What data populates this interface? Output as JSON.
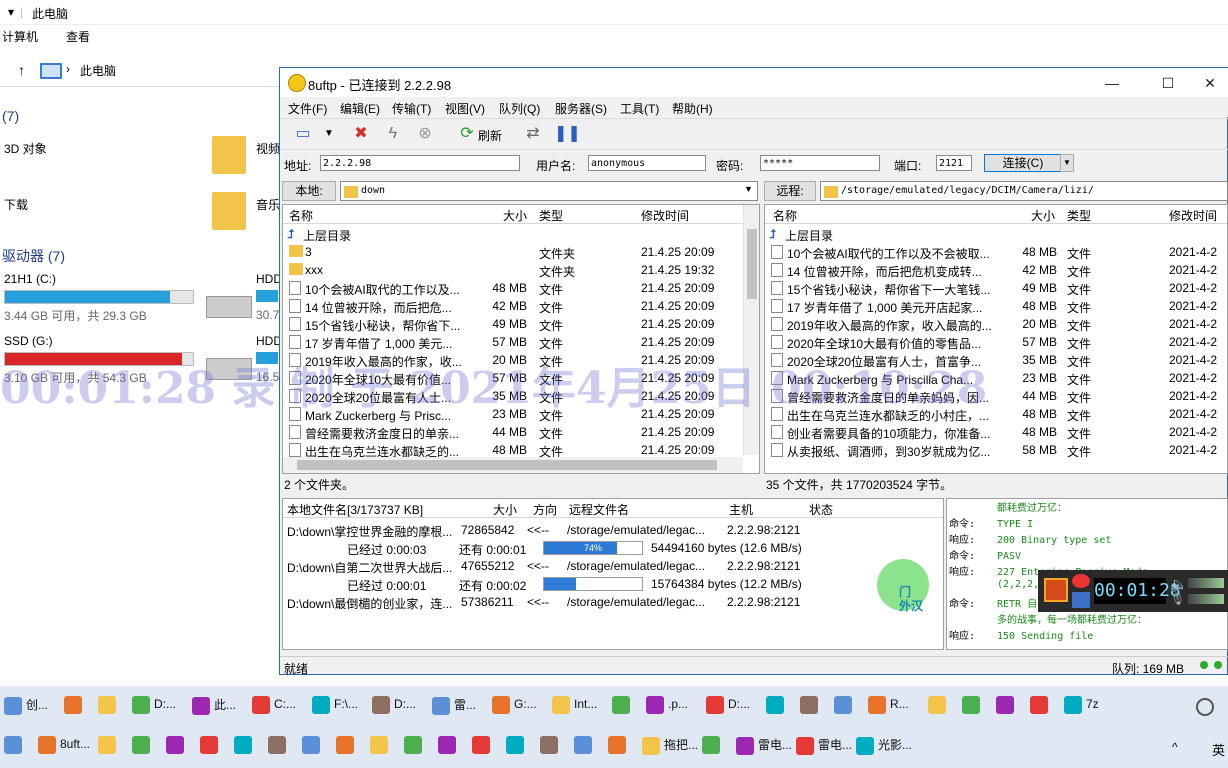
{
  "explorer": {
    "title": "此电脑",
    "menu": [
      "计算机",
      "查看"
    ],
    "address": "此电脑",
    "folders_header": "(7)",
    "folders": [
      {
        "label": "3D 对象"
      },
      {
        "label": "视频"
      },
      {
        "label": "下载"
      },
      {
        "label": "音乐"
      }
    ],
    "drives_header": "驱动器 (7)",
    "drives": [
      {
        "name": "21H1 (C:)",
        "info": "3.44 GB 可用，共 29.3 GB",
        "used": 0.88,
        "color": "#26a0da"
      },
      {
        "name": "SSD (G:)",
        "info": "3.10 GB 可用，共 54.3 GB",
        "used": 0.94,
        "color": "#da2626"
      },
      {
        "name": "HDD",
        "info": "30.7",
        "used": 0.5,
        "color": "#26a0da"
      },
      {
        "name": "HDD",
        "info": "16.5",
        "used": 0.5,
        "color": "#26a0da"
      }
    ]
  },
  "window": {
    "title": "8uftp - 已连接到 2.2.2.98",
    "controls": [
      "—",
      "☐",
      "✕"
    ],
    "menu": [
      "文件(F)",
      "编辑(E)",
      "传输(T)",
      "视图(V)",
      "队列(Q)",
      "服务器(S)",
      "工具(T)",
      "帮助(H)"
    ],
    "toolbar": {
      "refresh": "刷新"
    },
    "connection": {
      "addr_label": "地址:",
      "addr": "2.2.2.98",
      "user_label": "用户名:",
      "user": "anonymous",
      "pwd_label": "密码:",
      "pwd": "*****",
      "port_label": "端口:",
      "port": "2121",
      "connect": "连接(C)"
    },
    "local": {
      "label": "本地:",
      "path": "down",
      "headers": {
        "name": "名称",
        "size": "大小",
        "type": "类型",
        "mtime": "修改时间"
      },
      "parent": "上层目录",
      "rows": [
        {
          "name": "3",
          "size": "",
          "type": "文件夹",
          "mtime": "21.4.25 20:09",
          "dir": true
        },
        {
          "name": "xxx",
          "size": "",
          "type": "文件夹",
          "mtime": "21.4.25 19:32",
          "dir": true
        },
        {
          "name": "10个会被AI取代的工作以及...",
          "size": "48 MB",
          "type": "文件",
          "mtime": "21.4.25 20:09"
        },
        {
          "name": "14 位曾被开除，而后把危...",
          "size": "42 MB",
          "type": "文件",
          "mtime": "21.4.25 20:09"
        },
        {
          "name": "15个省钱小秘诀，帮你省下...",
          "size": "49 MB",
          "type": "文件",
          "mtime": "21.4.25 20:09"
        },
        {
          "name": "17 岁青年借了 1,000 美元...",
          "size": "57 MB",
          "type": "文件",
          "mtime": "21.4.25 20:09"
        },
        {
          "name": "2019年收入最高的作家，收...",
          "size": "20 MB",
          "type": "文件",
          "mtime": "21.4.25 20:09"
        },
        {
          "name": "2020年全球10大最有价值...",
          "size": "57 MB",
          "type": "文件",
          "mtime": "21.4.25 20:09"
        },
        {
          "name": "2020全球20位最富有人士...",
          "size": "35 MB",
          "type": "文件",
          "mtime": "21.4.25 20:09"
        },
        {
          "name": "Mark Zuckerberg 与 Prisc...",
          "size": "23 MB",
          "type": "文件",
          "mtime": "21.4.25 20:09"
        },
        {
          "name": "曾经需要救济金度日的单亲...",
          "size": "44 MB",
          "type": "文件",
          "mtime": "21.4.25 20:09"
        },
        {
          "name": "出生在乌克兰连水都缺乏的...",
          "size": "48 MB",
          "type": "文件",
          "mtime": "21.4.25 20:09"
        }
      ],
      "status": "2 个文件夹。"
    },
    "remote": {
      "label": "远程:",
      "path": "/storage/emulated/legacy/DCIM/Camera/lizi/",
      "headers": {
        "name": "名称",
        "size": "大小",
        "type": "类型",
        "mtime": "修改时间"
      },
      "parent": "上层目录",
      "rows": [
        {
          "name": "10个会被AI取代的工作以及不会被取...",
          "size": "48 MB",
          "type": "文件",
          "mtime": "2021-4-2"
        },
        {
          "name": "14 位曾被开除，而后把危机变成转...",
          "size": "42 MB",
          "type": "文件",
          "mtime": "2021-4-2"
        },
        {
          "name": "15个省钱小秘诀，帮你省下一大笔钱...",
          "size": "49 MB",
          "type": "文件",
          "mtime": "2021-4-2"
        },
        {
          "name": "17 岁青年借了 1,000 美元开店起家...",
          "size": "48 MB",
          "type": "文件",
          "mtime": "2021-4-2"
        },
        {
          "name": "2019年收入最高的作家，收入最高的...",
          "size": "20 MB",
          "type": "文件",
          "mtime": "2021-4-2"
        },
        {
          "name": "2020年全球10大最有价值的零售品...",
          "size": "57 MB",
          "type": "文件",
          "mtime": "2021-4-2"
        },
        {
          "name": "2020全球20位最富有人士，首富争...",
          "size": "35 MB",
          "type": "文件",
          "mtime": "2021-4-2"
        },
        {
          "name": "Mark Zuckerberg 与 Priscilla Cha...",
          "size": "23 MB",
          "type": "文件",
          "mtime": "2021-4-2"
        },
        {
          "name": "曾经需要救济金度日的单亲妈妈，因...",
          "size": "44 MB",
          "type": "文件",
          "mtime": "2021-4-2"
        },
        {
          "name": "出生在乌克兰连水都缺乏的小村庄，...",
          "size": "48 MB",
          "type": "文件",
          "mtime": "2021-4-2"
        },
        {
          "name": "创业者需要具备的10项能力，你准备...",
          "size": "48 MB",
          "type": "文件",
          "mtime": "2021-4-2"
        },
        {
          "name": "从卖报纸、调酒师，到30岁就成为亿...",
          "size": "58 MB",
          "type": "文件",
          "mtime": "2021-4-2"
        }
      ],
      "status": "35 个文件，共 1770203524 字节。"
    },
    "queue": {
      "headers": {
        "local": "本地文件名[3/173737 KB]",
        "size": "大小",
        "dir": "方向",
        "remote": "远程文件名",
        "host": "主机",
        "state": "状态"
      },
      "items": [
        {
          "local": "D:\\down\\掌控世界金融的摩根...",
          "size": "72865842",
          "dir": "<<--",
          "remote": "/storage/emulated/legac...",
          "host": "2.2.2.98:2121",
          "elapsed": "已经过 0:00:03",
          "remain": "还有 0:00:01",
          "pct": "74%",
          "fill": 0.74,
          "speed": "54494160 bytes (12.6 MB/s)"
        },
        {
          "local": "D:\\down\\自第二次世界大战后...",
          "size": "47655212",
          "dir": "<<--",
          "remote": "/storage/emulated/legac...",
          "host": "2.2.2.98:2121",
          "elapsed": "已经过 0:00:01",
          "remain": "还有 0:00:02",
          "pct": "33%",
          "fill": 0.33,
          "speed": "15764384 bytes (12.2 MB/s)"
        },
        {
          "local": "D:\\down\\最倒楣的创业家，连...",
          "size": "57386211",
          "dir": "<<--",
          "remote": "/storage/emulated/legac...",
          "host": "2.2.2.98:2121"
        }
      ]
    },
    "log": [
      {
        "l": "",
        "t": "都耗费过万亿："
      },
      {
        "l": "命令:",
        "t": "TYPE I"
      },
      {
        "l": "响应:",
        "t": "200 Binary type set"
      },
      {
        "l": "命令:",
        "t": "PASV"
      },
      {
        "l": "响应:",
        "t": "227 Entering Passive Mode"
      },
      {
        "l": "",
        "t": "(2,2,2,98,170,2"
      },
      {
        "l": "命令:",
        "t": "RETR 自"
      },
      {
        "l": "",
        "t": "多的战事，每一场都耗费过万亿："
      },
      {
        "l": "响应:",
        "t": "150 Sending file"
      }
    ],
    "overlay_text": "门\n外汉",
    "statusbar": {
      "left": "就绪",
      "queue": "队列: 169 MB"
    }
  },
  "recorder": {
    "time": "00:01:28"
  },
  "watermark": "00:01:28  录  制  于  2021年4月25日  00:10:28",
  "taskbar": {
    "row1": [
      "创...",
      "",
      "",
      "D:...",
      "此...",
      "C:...",
      "F:\\...",
      "D:...",
      "雷...",
      "G:...",
      "Int...",
      "",
      ".p...",
      "D:...",
      "",
      "",
      "",
      "R...",
      "",
      "",
      "",
      "",
      "7z"
    ],
    "row2": [
      "",
      "8uft...",
      "",
      "",
      "",
      "",
      "",
      "",
      "",
      "",
      "",
      "",
      "",
      "",
      "",
      "",
      "",
      "",
      "拖把...",
      "",
      "雷电...",
      "雷电...",
      "光影..."
    ],
    "ime": "英"
  }
}
